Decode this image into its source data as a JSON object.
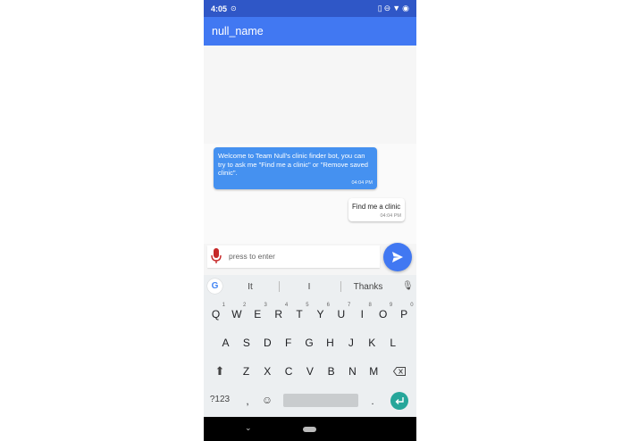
{
  "status_bar": {
    "time": "4:05",
    "cast_icon": "cast-icon",
    "right_icons": [
      "vibrate-icon",
      "dnd-icon",
      "wifi-icon",
      "sync-icon"
    ]
  },
  "app_bar": {
    "title": "null_name"
  },
  "chat": {
    "messages": [
      {
        "sender": "bot",
        "text": "Welcome to Team Null's clinic finder bot, you can try to ask me \"Find me a clinic\" or \"Remove saved clinic\".",
        "time": "04:04 PM"
      },
      {
        "sender": "user",
        "text": "Find me a clinic",
        "time": "04:04 PM"
      }
    ]
  },
  "input": {
    "placeholder": "press to enter",
    "value": "",
    "mic_icon": "mic-icon",
    "send_icon": "send-icon"
  },
  "keyboard": {
    "suggestions": [
      "It",
      "I",
      "Thanks"
    ],
    "row1": [
      {
        "k": "Q",
        "h": "1"
      },
      {
        "k": "W",
        "h": "2"
      },
      {
        "k": "E",
        "h": "3"
      },
      {
        "k": "R",
        "h": "4"
      },
      {
        "k": "T",
        "h": "5"
      },
      {
        "k": "Y",
        "h": "6"
      },
      {
        "k": "U",
        "h": "7"
      },
      {
        "k": "I",
        "h": "8"
      },
      {
        "k": "O",
        "h": "9"
      },
      {
        "k": "P",
        "h": "0"
      }
    ],
    "row2": [
      "A",
      "S",
      "D",
      "F",
      "G",
      "H",
      "J",
      "K",
      "L"
    ],
    "row3": [
      "Z",
      "X",
      "C",
      "V",
      "B",
      "N",
      "M"
    ],
    "symbols_label": "?123",
    "comma_label": ",",
    "period_label": "."
  },
  "colors": {
    "status_bar": "#2f57c7",
    "app_bar": "#4178f2",
    "bot_bubble": "#4591f0",
    "send_button": "#4178f2",
    "enter_key": "#26a69a",
    "mic": "#c62828"
  }
}
